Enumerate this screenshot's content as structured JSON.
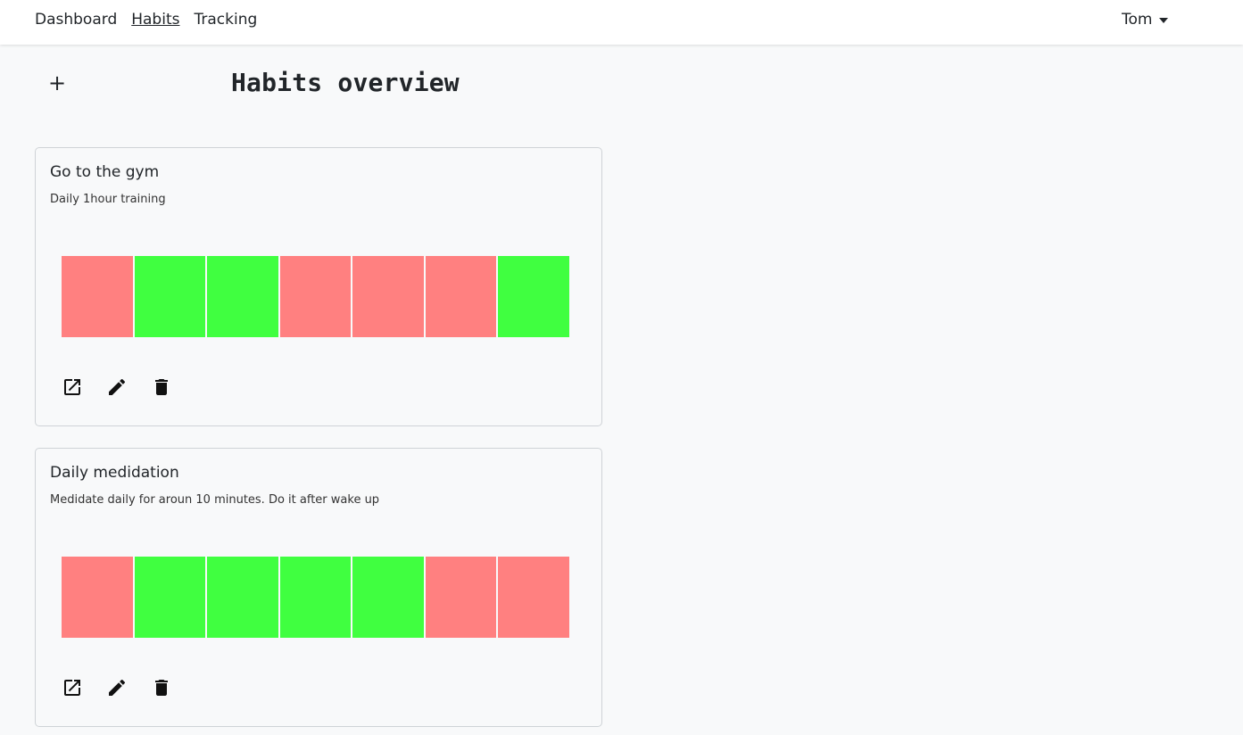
{
  "nav": {
    "links": [
      {
        "label": "Dashboard",
        "active": false
      },
      {
        "label": "Habits",
        "active": true
      },
      {
        "label": "Tracking",
        "active": false
      }
    ],
    "user": "Tom"
  },
  "page": {
    "add_label": "+",
    "title": "Habits overview"
  },
  "colors": {
    "done": "#40ff40",
    "missed": "#ff8080"
  },
  "habits": [
    {
      "title": "Go to the gym",
      "description": "Daily 1hour training",
      "days": [
        "missed",
        "done",
        "done",
        "missed",
        "missed",
        "missed",
        "done"
      ],
      "actions": [
        "open-icon",
        "edit-icon",
        "delete-icon"
      ]
    },
    {
      "title": "Daily medidation",
      "description": "Medidate daily for aroun 10 minutes. Do it after wake up",
      "days": [
        "missed",
        "done",
        "done",
        "done",
        "done",
        "missed",
        "missed"
      ],
      "actions": [
        "open-icon",
        "edit-icon",
        "delete-icon"
      ]
    }
  ]
}
